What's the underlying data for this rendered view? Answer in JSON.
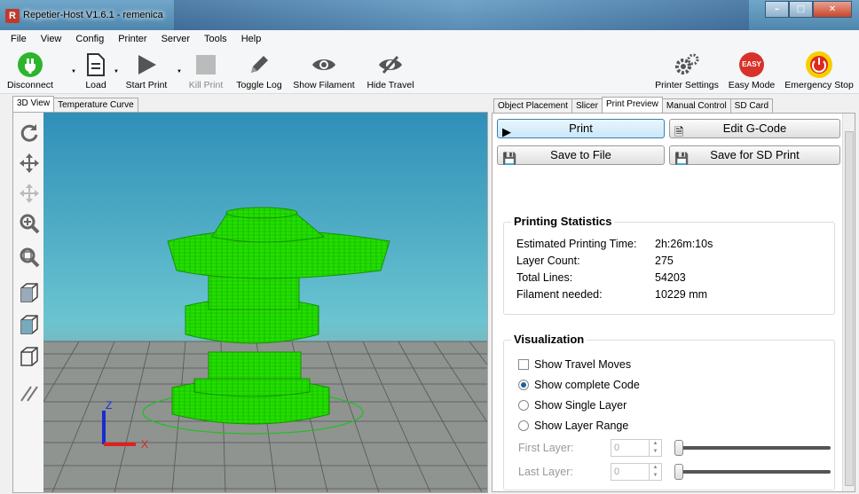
{
  "window": {
    "title": "Repetier-Host V1.6.1 - remenica",
    "app_icon": "R"
  },
  "menu": [
    "File",
    "View",
    "Config",
    "Printer",
    "Server",
    "Tools",
    "Help"
  ],
  "toolbar": {
    "disconnect": "Disconnect",
    "load": "Load",
    "start_print": "Start Print",
    "kill_print": "Kill Print",
    "toggle_log": "Toggle Log",
    "show_filament": "Show Filament",
    "hide_travel": "Hide Travel",
    "printer_settings": "Printer Settings",
    "easy_mode": "Easy Mode",
    "easy_badge": "EASY",
    "emergency_stop": "Emergency Stop"
  },
  "left_tabs": [
    "3D View",
    "Temperature Curve"
  ],
  "right_tabs": [
    "Object Placement",
    "Slicer",
    "Print Preview",
    "Manual Control",
    "SD Card"
  ],
  "preview": {
    "print_label": "Print",
    "edit_gcode_label": "Edit G-Code",
    "save_file_label": "Save to File",
    "save_sd_label": "Save for SD Print"
  },
  "stats": {
    "title": "Printing Statistics",
    "rows": [
      {
        "label": "Estimated Printing Time:",
        "value": "2h:26m:10s"
      },
      {
        "label": "Layer Count:",
        "value": "275"
      },
      {
        "label": "Total Lines:",
        "value": "54203"
      },
      {
        "label": "Filament needed:",
        "value": "10229 mm"
      }
    ]
  },
  "visualization": {
    "title": "Visualization",
    "show_travel": "Show Travel Moves",
    "show_complete": "Show complete Code",
    "show_single": "Show Single Layer",
    "show_range": "Show Layer Range",
    "first_layer_label": "First Layer:",
    "first_layer_value": "0",
    "last_layer_label": "Last Layer:",
    "last_layer_value": "0"
  },
  "axes": {
    "x": "X",
    "z": "Z"
  },
  "colors": {
    "model": "#22e000",
    "accent_blue": "#3c7fb1",
    "axis_x": "#e02020",
    "axis_z": "#1a2ad0"
  }
}
